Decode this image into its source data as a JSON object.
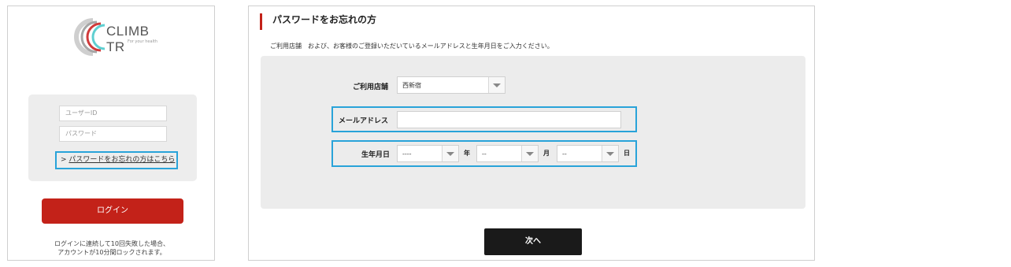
{
  "login": {
    "logo_text": "CLIMB TR",
    "logo_tagline": "For your health",
    "user_id_placeholder": "ユーザーID",
    "password_placeholder": "パスワード",
    "forgot_prefix": ">",
    "forgot_link": "パスワードをお忘れの方はこちら",
    "login_button": "ログイン",
    "lock_note_line1": "ログインに連続して10回失敗した場合、",
    "lock_note_line2": "アカウントが10分間ロックされます。"
  },
  "form": {
    "heading": "パスワードをお忘れの方",
    "instruction": "ご利用店舗　および、お客様のご登録いただいているメールアドレスと生年月日をご入力ください。",
    "store_label": "ご利用店舗",
    "store_value": "西新宿",
    "email_label": "メールアドレス",
    "email_value": "",
    "birth_label": "生年月日",
    "year_value": "----",
    "year_unit": "年",
    "month_value": "--",
    "month_unit": "月",
    "day_value": "--",
    "day_unit": "日",
    "next_button": "次へ"
  },
  "colors": {
    "accent_red": "#c32219",
    "highlight_blue": "#29a3d9",
    "next_button_bg": "#1a1a1a"
  },
  "icons": {
    "logo": "climb-tr-logo-icon",
    "select_arrow": "chevron-down-icon"
  }
}
